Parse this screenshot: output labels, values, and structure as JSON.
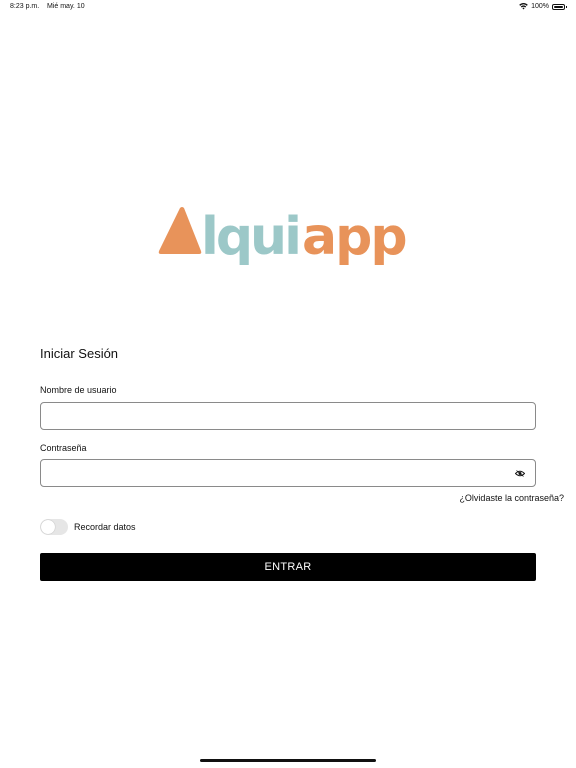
{
  "status_bar": {
    "time": "8:23 p.m.",
    "date": "Mié may. 10",
    "battery": "100%",
    "icons": [
      "wifi-icon",
      "battery-icon"
    ]
  },
  "logo": {
    "text_part_1": "lqui",
    "text_part_2": "app",
    "colors": {
      "orange": "#e8935a",
      "teal": "#9cc8c8"
    }
  },
  "login": {
    "title": "Iniciar Sesión",
    "username_label": "Nombre de usuario",
    "username_value": "",
    "password_label": "Contraseña",
    "password_value": "",
    "password_toggle_icon": "eye-icon",
    "forgot_link": "¿Olvidaste la contraseña?",
    "remember_label": "Recordar datos",
    "remember_enabled": false,
    "submit_label": "ENTRAR"
  }
}
